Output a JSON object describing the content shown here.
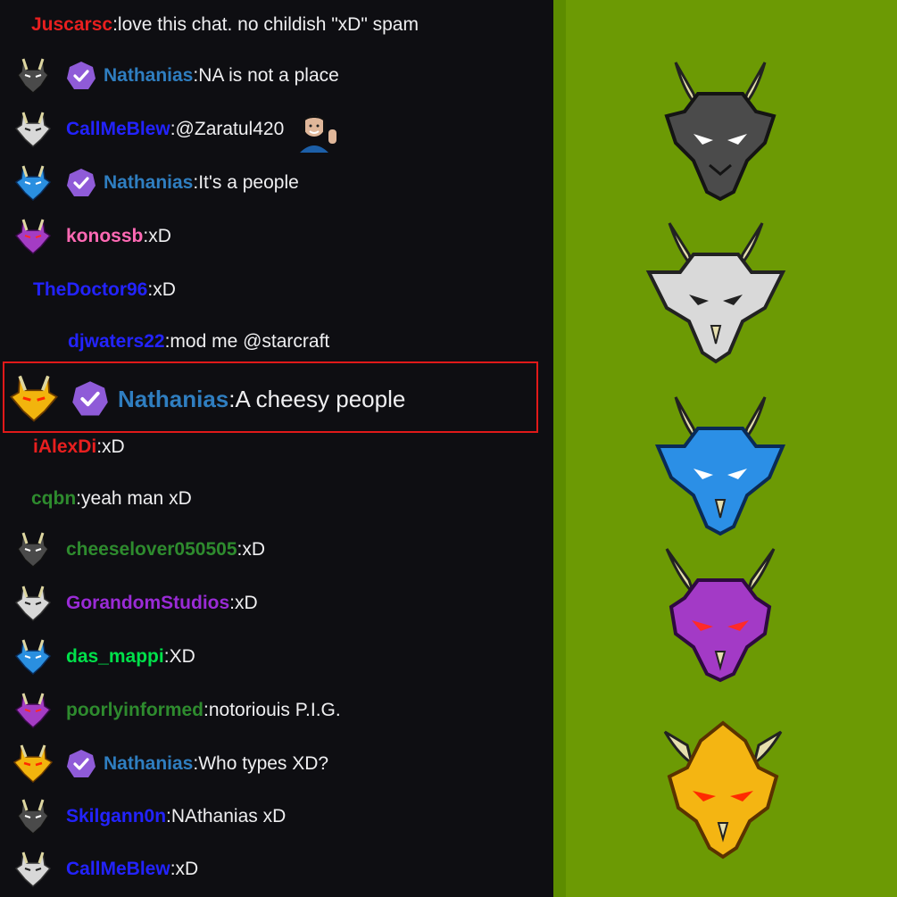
{
  "chat": {
    "messages": [
      {
        "user": "Juscarsc",
        "text": "love this chat. no childish \"xD\" spam",
        "color": "#e81f1f",
        "avatar": null,
        "badge": false
      },
      {
        "user": "Nathanias",
        "text": "NA is not a place",
        "color": "#2f7ec0",
        "avatar": "black-dragon",
        "badge": true
      },
      {
        "user": "CallMeBlew",
        "text": "@Zaratul420",
        "color": "#2323ff",
        "avatar": "white-dragon",
        "badge": false,
        "emote": "waving-person-emote"
      },
      {
        "user": "Nathanias",
        "text": "It's a people",
        "color": "#2f7ec0",
        "avatar": "blue-dragon",
        "badge": true
      },
      {
        "user": "konossb",
        "text": "xD",
        "color": "#ff69b4",
        "avatar": "purple-dragon",
        "badge": false
      },
      {
        "user": "TheDoctor96",
        "text": "xD",
        "color": "#2323ff",
        "avatar": null,
        "badge": false
      },
      {
        "user": "djwaters22",
        "text": "mod me @starcraft",
        "color": "#2323ff",
        "avatar": null,
        "badge": false
      },
      {
        "user": "Nathanias",
        "text": "A cheesy people",
        "color": "#2f7ec0",
        "avatar": "gold-dragon",
        "badge": true,
        "highlighted": true
      },
      {
        "user": "iAlexDi",
        "text": "xD",
        "color": "#e81f1f",
        "avatar": null,
        "badge": false
      },
      {
        "user": "cqbn",
        "text": "yeah man xD",
        "color": "#2e8b2e",
        "avatar": null,
        "badge": false
      },
      {
        "user": "cheeselover050505",
        "text": "xD",
        "color": "#2e8b2e",
        "avatar": "black-dragon",
        "badge": false
      },
      {
        "user": "GorandomStudios",
        "text": "xD",
        "color": "#9a2bd6",
        "avatar": "white-dragon",
        "badge": false
      },
      {
        "user": "das_mappi",
        "text": "XD",
        "color": "#00e04a",
        "avatar": "blue-dragon",
        "badge": false
      },
      {
        "user": "poorlyinformed",
        "text": "notoriouis P.I.G.",
        "color": "#2e8b2e",
        "avatar": "purple-dragon",
        "badge": false
      },
      {
        "user": "Nathanias",
        "text": "Who types XD?",
        "color": "#2f7ec0",
        "avatar": "gold-dragon",
        "badge": true
      },
      {
        "user": "Skilgann0n",
        "text": "NAthanias xD",
        "color": "#2323ff",
        "avatar": "black-dragon",
        "badge": false
      },
      {
        "user": "CallMeBlew",
        "text": "xD",
        "color": "#2323ff",
        "avatar": "white-dragon",
        "badge": false
      }
    ]
  },
  "panel": {
    "background": "#6c9a04",
    "emotes": [
      "black-dragon-emote",
      "white-dragon-emote",
      "blue-dragon-emote",
      "purple-dragon-emote",
      "gold-dragon-emote"
    ]
  },
  "colors": {
    "chat_bg": "#0e0e12",
    "highlight_border": "#e01919",
    "badge": "#8f5bd8"
  }
}
